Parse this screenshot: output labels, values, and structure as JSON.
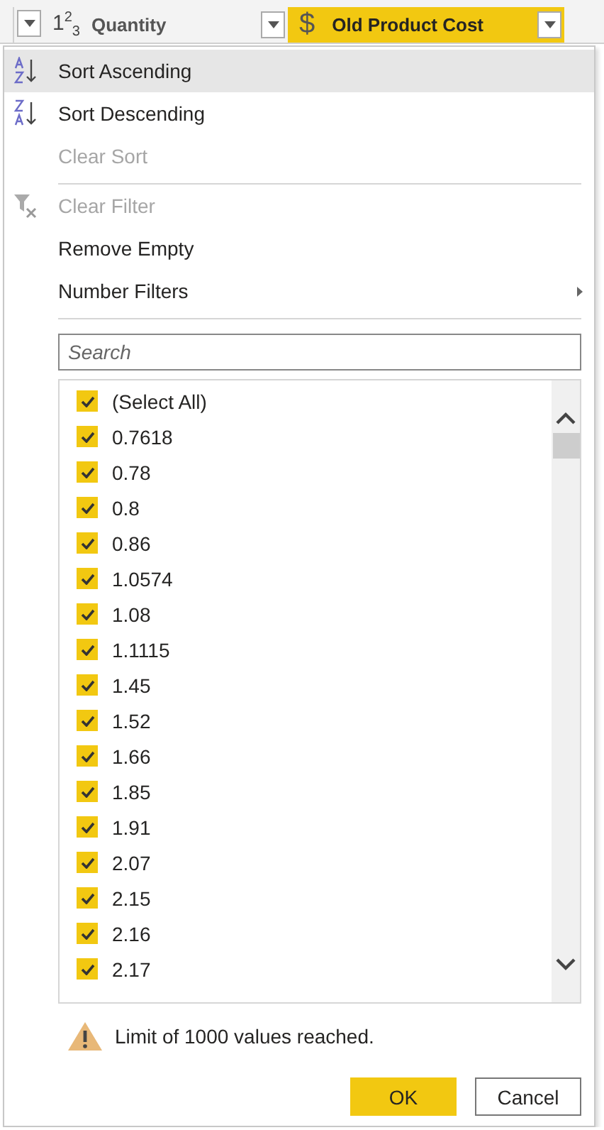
{
  "columns": [
    {
      "type_icon": "1$^{2}$$_{3}$",
      "name": "Quantity",
      "selected": false
    },
    {
      "type_icon": "$",
      "name": "Old Product Cost",
      "selected": true
    }
  ],
  "menu": [
    {
      "kind": "sort_asc",
      "label": "Sort Ascending",
      "disabled": false,
      "highlighted": true,
      "submenu": false,
      "divider_after": false
    },
    {
      "kind": "sort_desc",
      "label": "Sort Descending",
      "disabled": false,
      "highlighted": false,
      "submenu": false,
      "divider_after": false
    },
    {
      "kind": "plain",
      "label": "Clear Sort",
      "disabled": true,
      "highlighted": false,
      "submenu": false,
      "divider_after": true
    },
    {
      "kind": "clear_filter",
      "label": "Clear Filter",
      "disabled": true,
      "highlighted": false,
      "submenu": false,
      "divider_after": false
    },
    {
      "kind": "plain",
      "label": "Remove Empty",
      "disabled": false,
      "highlighted": false,
      "submenu": false,
      "divider_after": false
    },
    {
      "kind": "plain",
      "label": "Number Filters",
      "disabled": false,
      "highlighted": false,
      "submenu": true,
      "divider_after": true
    }
  ],
  "search": {
    "placeholder": "Search"
  },
  "values": [
    {
      "label": "(Select All)",
      "checked": true
    },
    {
      "label": "0.7618",
      "checked": true
    },
    {
      "label": "0.78",
      "checked": true
    },
    {
      "label": "0.8",
      "checked": true
    },
    {
      "label": "0.86",
      "checked": true
    },
    {
      "label": "1.0574",
      "checked": true
    },
    {
      "label": "1.08",
      "checked": true
    },
    {
      "label": "1.1115",
      "checked": true
    },
    {
      "label": "1.45",
      "checked": true
    },
    {
      "label": "1.52",
      "checked": true
    },
    {
      "label": "1.66",
      "checked": true
    },
    {
      "label": "1.85",
      "checked": true
    },
    {
      "label": "1.91",
      "checked": true
    },
    {
      "label": "2.07",
      "checked": true
    },
    {
      "label": "2.15",
      "checked": true
    },
    {
      "label": "2.16",
      "checked": true
    },
    {
      "label": "2.17",
      "checked": true
    }
  ],
  "warning": "Limit of 1000 values reached.",
  "buttons": [
    {
      "label": "OK",
      "kind": "primary"
    },
    {
      "label": "Cancel",
      "kind": "secondary"
    }
  ]
}
